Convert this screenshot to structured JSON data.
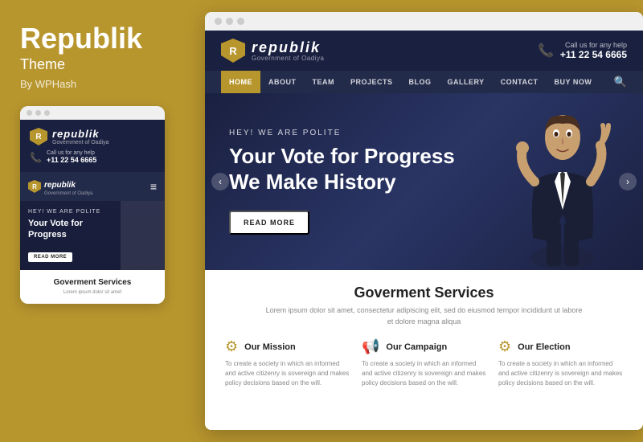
{
  "left": {
    "title": "Republik",
    "subtitle": "Theme",
    "by": "By WPHash",
    "mobile_dots": [
      "dot1",
      "dot2",
      "dot3"
    ],
    "mobile_header": {
      "logo_letter": "R",
      "logo_main": "republik",
      "logo_sub": "Government of Oadiya",
      "contact_label": "Call us for any help",
      "contact_number": "+11 22 54 6665"
    },
    "mobile_nav": {
      "logo_main": "republik",
      "logo_sub": "Government of Oadiya",
      "hamburger": "≡"
    },
    "mobile_hero": {
      "tagline": "HEY! WE ARE POLITE",
      "title": "Your Vote for Progress",
      "btn": "READ MORE"
    },
    "mobile_services": {
      "title": "Goverment Services",
      "desc": "Lorem ipsum dolor sit amet"
    }
  },
  "desktop": {
    "titlebar_dots": [
      "dot1",
      "dot2",
      "dot3"
    ],
    "header": {
      "logo_letter": "R",
      "logo_main": "republik",
      "logo_sub": "Government of Oadiya",
      "call_label": "Call us for any help",
      "phone": "+11 22 54 6665"
    },
    "nav": {
      "items": [
        "HOME",
        "ABOUT",
        "TEAM",
        "PROJECTS",
        "BLOG",
        "GALLERY",
        "CONTACT",
        "BUY NOW"
      ],
      "active": "HOME"
    },
    "hero": {
      "tagline": "HEY! WE ARE POLITE",
      "title_line1": "Your Vote for Progress",
      "title_line2": "We Make History",
      "btn": "READ MORE"
    },
    "services": {
      "title": "Goverment Services",
      "desc": "Lorem ipsum dolor sit amet, consectetur adipiscing elit, sed do eiusmod tempor incididunt ut labore et dolore magna aliqua",
      "items": [
        {
          "icon": "⚙",
          "name": "Our Mission",
          "text": "To create a society in which an informed and active citizenry is sovereign and makes policy decisions based on the will."
        },
        {
          "icon": "📢",
          "name": "Our Campaign",
          "text": "To create a society in which an informed and active citizenry is sovereign and makes policy decisions based on the will."
        },
        {
          "icon": "⚙",
          "name": "Our Election",
          "text": "To create a society in which an informed and active citizenry is sovereign and makes policy decisions based on the will."
        }
      ]
    }
  }
}
